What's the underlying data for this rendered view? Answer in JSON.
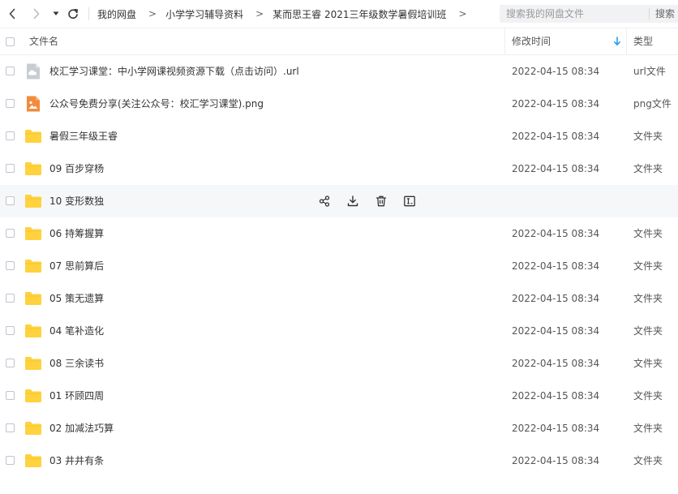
{
  "nav": {
    "back_icon": "chevron-left-icon",
    "forward_icon": "chevron-right-icon",
    "dropdown_icon": "caret-down-icon",
    "refresh_icon": "refresh-icon"
  },
  "breadcrumb": [
    "我的网盘",
    "小学学习辅导资料",
    "某而思王睿 2021三年级数学暑假培训班"
  ],
  "breadcrumb_sep": ">",
  "search": {
    "placeholder": "搜索我的网盘文件",
    "button": "搜索"
  },
  "table": {
    "col_name": "文件名",
    "col_modified": "修改时间",
    "col_type": "类型",
    "sort_icon": "arrow-down-icon",
    "accent_color": "#2b9bf4"
  },
  "files": [
    {
      "name": "校汇学习课堂：中小学网课视频资源下载（点击访问）.url",
      "date": "2022-04-15 08:34",
      "type": "url文件",
      "icon": "url-file-icon"
    },
    {
      "name": "公众号免费分享(关注公众号：校汇学习课堂).png",
      "date": "2022-04-15 08:34",
      "type": "png文件",
      "icon": "image-file-icon"
    },
    {
      "name": "暑假三年级王睿",
      "date": "2022-04-15 08:34",
      "type": "文件夹",
      "icon": "folder-icon"
    },
    {
      "name": "09 百步穿杨",
      "date": "2022-04-15 08:34",
      "type": "文件夹",
      "icon": "folder-icon"
    },
    {
      "name": "10 变形数独",
      "date": "",
      "type": "",
      "icon": "folder-icon"
    },
    {
      "name": "06 持筹握算",
      "date": "2022-04-15 08:34",
      "type": "文件夹",
      "icon": "folder-icon"
    },
    {
      "name": "07 思前算后",
      "date": "2022-04-15 08:34",
      "type": "文件夹",
      "icon": "folder-icon"
    },
    {
      "name": "05 策无遗算",
      "date": "2022-04-15 08:34",
      "type": "文件夹",
      "icon": "folder-icon"
    },
    {
      "name": "04 笔补造化",
      "date": "2022-04-15 08:34",
      "type": "文件夹",
      "icon": "folder-icon"
    },
    {
      "name": "08 三余读书",
      "date": "2022-04-15 08:34",
      "type": "文件夹",
      "icon": "folder-icon"
    },
    {
      "name": "01 环顾四周",
      "date": "2022-04-15 08:34",
      "type": "文件夹",
      "icon": "folder-icon"
    },
    {
      "name": "02 加减法巧算",
      "date": "2022-04-15 08:34",
      "type": "文件夹",
      "icon": "folder-icon"
    },
    {
      "name": "03 井井有条",
      "date": "2022-04-15 08:34",
      "type": "文件夹",
      "icon": "folder-icon"
    }
  ],
  "hover_actions": [
    "share-icon",
    "download-icon",
    "delete-icon",
    "rename-icon"
  ],
  "colors": {
    "folder": "#ffd23e",
    "image_file": "#f28b3b",
    "url_file": "#c9ccd2",
    "hover_row": "#f6f7f9"
  }
}
